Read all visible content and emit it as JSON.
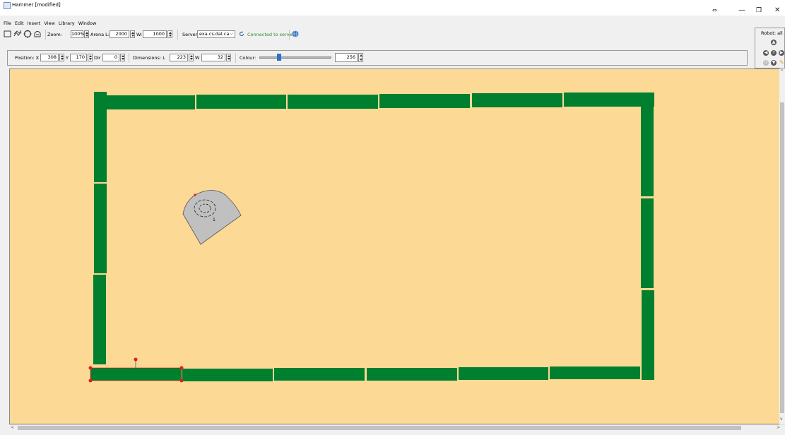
{
  "window": {
    "title": "Hammer [modified]",
    "restore_glyph": "⇔",
    "minimize_glyph": "—",
    "maximize_glyph": "❐",
    "close_glyph": "✕"
  },
  "menu": [
    "File",
    "Edit",
    "Insert",
    "View",
    "Library",
    "Window"
  ],
  "toolbar": {
    "zoom_label": "Zoom:",
    "zoom_value": "100%",
    "arena_label": "Arena L:",
    "arena_length": "2000",
    "arena_w_label": "W:",
    "arena_width": "1000",
    "server_label": "Server:",
    "server_value": "exa.cs.dal.ca",
    "status_text": "Connected to server",
    "status_color": "#2e8b2e"
  },
  "properties": {
    "position_label": "Position: X",
    "x": "308",
    "y_label": "Y",
    "y": "170",
    "dir_label": "Dir",
    "dir": "0",
    "dimensions_label": "Dimensions: L",
    "length": "223",
    "w_label": "W",
    "width": "32",
    "colour_label": "Colour:",
    "colour_slider_fraction": 0.26,
    "colour_value": "256"
  },
  "robot_panel": {
    "label": "Robot: all"
  },
  "arena": {
    "background": "#fdd996",
    "wall_color": "#00802f",
    "robot_color": "#c0c0c0",
    "robot_label": "1",
    "selection_handle_color": "#e81a1a"
  },
  "icons": [
    "rectangle-tool-icon",
    "polyline-tool-icon",
    "circle-tool-icon",
    "robot-tool-icon",
    "refresh-icon",
    "globe-icon"
  ]
}
